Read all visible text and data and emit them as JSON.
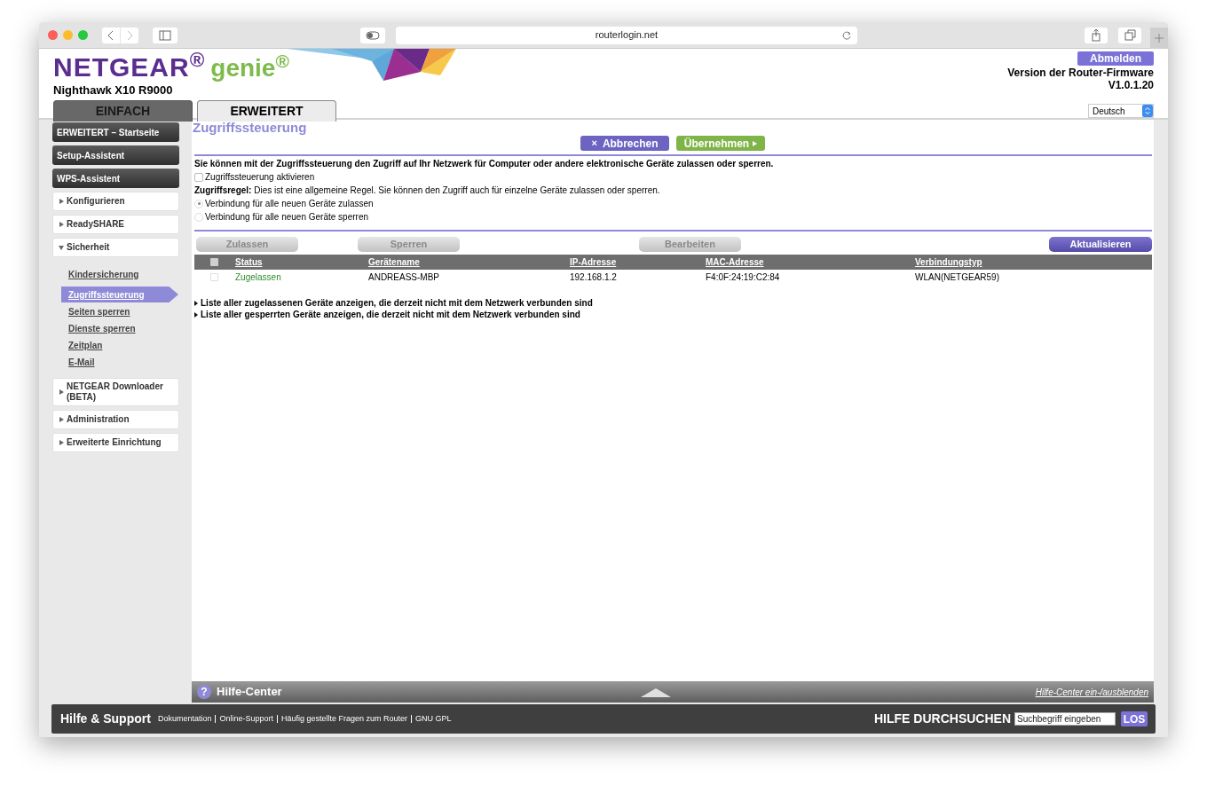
{
  "browser": {
    "url": "routerlogin.net"
  },
  "header": {
    "brand": "NETGEAR$^{®}$",
    "product": "genie$^{®}$",
    "model": "Nighthawk X10 R9000",
    "logout": "Abmelden",
    "firmware_label": "Version der Router-Firmware",
    "firmware_version": "V1.0.1.20",
    "language": "Deutsch"
  },
  "tabs": [
    {
      "label": "EINFACH",
      "selected": false
    },
    {
      "label": "ERWEITERT",
      "selected": true
    }
  ],
  "sidebar": [
    {
      "kind": "button",
      "label": "ERWEITERT – Startseite"
    },
    {
      "kind": "button",
      "label": "Setup-Assistent"
    },
    {
      "kind": "button",
      "label": "WPS-Assistent"
    },
    {
      "kind": "section",
      "label": "Konfigurieren",
      "expanded": false
    },
    {
      "kind": "section",
      "label": "ReadySHARE",
      "expanded": false
    },
    {
      "kind": "section",
      "label": "Sicherheit",
      "expanded": true,
      "children": [
        {
          "label": "Kindersicherung",
          "selected": false
        },
        {
          "label": "Zugriffssteuerung",
          "selected": true
        },
        {
          "label": "Seiten sperren",
          "selected": false
        },
        {
          "label": "Dienste sperren",
          "selected": false
        },
        {
          "label": "Zeitplan",
          "selected": false
        },
        {
          "label": "E-Mail",
          "selected": false
        }
      ]
    },
    {
      "kind": "section",
      "label": "NETGEAR Downloader (BETA)",
      "expanded": false
    },
    {
      "kind": "section",
      "label": "Administration",
      "expanded": false
    },
    {
      "kind": "section",
      "label": "Erweiterte Einrichtung",
      "expanded": false
    }
  ],
  "content": {
    "title": "Zugriffssteuerung",
    "cancel_icon": "×",
    "cancel": "Abbrechen",
    "apply": "Übernehmen",
    "description": "Sie können mit der Zugriffssteuerung den Zugriff auf Ihr Netzwerk für Computer oder andere elektronische Geräte zulassen oder sperren.",
    "enable": {
      "label": "Zugriffssteuerung aktivieren",
      "checked": false
    },
    "rule": "**Zugriffsregel:** Dies ist eine allgemeine Regel. Sie können den Zugriff auch für einzelne Geräte zulassen oder sperren.",
    "radios": [
      {
        "label": "Verbindung für alle neuen Geräte zulassen",
        "selected": true
      },
      {
        "label": "Verbindung für alle neuen Geräte sperren",
        "selected": false
      }
    ],
    "actions": [
      {
        "label": "Zulassen",
        "disabled": true
      },
      {
        "label": "Sperren",
        "disabled": true
      },
      {
        "label": "Bearbeiten",
        "disabled": true
      },
      {
        "label": "Aktualisieren",
        "disabled": false
      }
    ],
    "table": {
      "all_checked": false,
      "columns": [
        "Status",
        "Gerätename",
        "IP-Adresse",
        "MAC-Adresse",
        "Verbindungstyp"
      ],
      "rows": [
        {
          "checked": false,
          "cells": [
            "Zugelassen",
            "ANDREASS-MBP",
            "192.168.1.2",
            "F4:0F:24:19:C2:84",
            "WLAN(NETGEAR59)"
          ]
        }
      ]
    },
    "expanders": [
      "Liste aller zugelassenen Geräte anzeigen, die derzeit nicht mit dem Netzwerk verbunden sind",
      "Liste aller gesperrten Geräte anzeigen, die derzeit nicht mit dem Netzwerk verbunden sind"
    ]
  },
  "help_center": {
    "icon": "?",
    "label": "Hilfe-Center",
    "toggle": "Hilfe-Center ein-/ausblenden"
  },
  "footer": {
    "title": "Hilfe & Support",
    "links": [
      "Dokumentation",
      "Online-Support",
      "Häufig gestellte Fragen zum Router",
      "GNU GPL"
    ],
    "search_label": "HILFE DURCHSUCHEN",
    "search_placeholder": "Suchbegriff eingeben",
    "search_button": "LOS"
  }
}
